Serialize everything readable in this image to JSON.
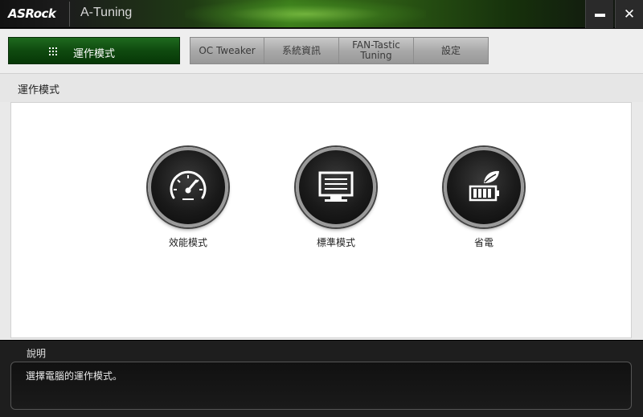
{
  "window": {
    "brand": "ASRock",
    "title": "A-Tuning",
    "minimize_icon": "minimize-icon",
    "close_icon": "close-icon"
  },
  "nav": {
    "active_label": "運作模式",
    "active_icon": "grid-icon",
    "tabs": [
      {
        "label": "OC Tweaker"
      },
      {
        "label": "系統資訊"
      },
      {
        "label": "FAN-Tastic Tuning"
      },
      {
        "label": "設定"
      }
    ]
  },
  "page": {
    "title": "運作模式"
  },
  "modes": [
    {
      "label": "效能模式",
      "icon": "speedometer-icon"
    },
    {
      "label": "標準模式",
      "icon": "monitor-icon"
    },
    {
      "label": "省電",
      "icon": "leaf-battery-icon"
    }
  ],
  "description": {
    "heading": "說明",
    "text": "選擇電腦的運作模式。"
  },
  "colors": {
    "accent_green": "#0f4a0f",
    "titlebar_green": "#3a7a1a"
  }
}
